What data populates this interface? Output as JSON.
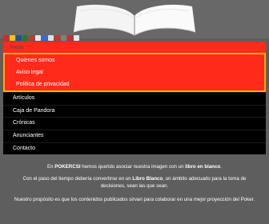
{
  "header": {
    "image_alt": "Libro blanco abierto",
    "flags": [
      "#d62828",
      "#f1c40f",
      "#1f4e9c",
      "#2b7a2b",
      "#c0392b",
      "#e8e8e8",
      "#3a6bd1",
      "#e0e0e0",
      "#c0392b",
      "#7f7f7f",
      "#d62828",
      "#e8e8e8"
    ]
  },
  "nav": {
    "top": "Inicio",
    "submenu": [
      "Quienes somos",
      "Aviso legal",
      "Política de privacidad"
    ],
    "items": [
      "Artículos",
      "Caja de Pandora",
      "Crónicas",
      "Anunciantes",
      "Contacto"
    ]
  },
  "content": {
    "p1_a": "En ",
    "p1_brand": "POKERCSI",
    "p1_b": " hemos querido asociar nuestra imagen con un ",
    "p1_bold": "libro en blanco",
    "p1_c": ".",
    "p2_a": "Con el paso del tiempo debería convertirse en un ",
    "p2_bold": "Libro Blanco",
    "p2_b": ", un ámbito adecuado para la toma de decisiones, sean las que sean.",
    "p3": "Nuestro propósito es que los contenidos publicados sirvan para colaborar en una mejor proyección del Poker."
  }
}
